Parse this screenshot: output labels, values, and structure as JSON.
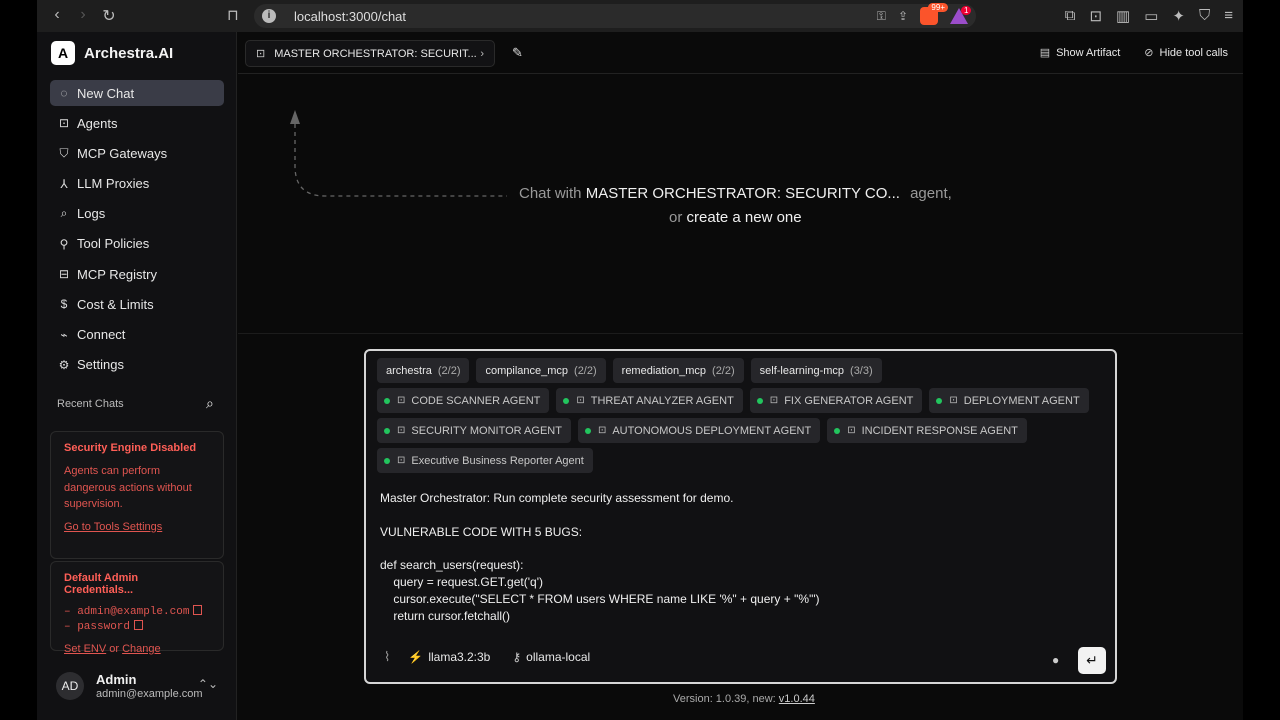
{
  "browser": {
    "url": "localhost:3000/chat",
    "badge_brave": "99+",
    "badge_alert": "1"
  },
  "app": {
    "name": "Archestra.AI",
    "logo_letter": "A"
  },
  "sidebar": {
    "items": [
      {
        "label": "New Chat",
        "icon": "chat-bubble-icon"
      },
      {
        "label": "Agents",
        "icon": "bot-icon"
      },
      {
        "label": "MCP Gateways",
        "icon": "shield-icon"
      },
      {
        "label": "LLM Proxies",
        "icon": "network-icon"
      },
      {
        "label": "Logs",
        "icon": "search-logs-icon"
      },
      {
        "label": "Tool Policies",
        "icon": "wrench-icon"
      },
      {
        "label": "MCP Registry",
        "icon": "router-icon"
      },
      {
        "label": "Cost & Limits",
        "icon": "dollar-icon"
      },
      {
        "label": "Connect",
        "icon": "plug-icon"
      },
      {
        "label": "Settings",
        "icon": "gear-icon"
      }
    ],
    "recent_label": "Recent Chats",
    "security_card": {
      "title": "Security Engine Disabled",
      "desc": "Agents can perform dangerous actions without supervision.",
      "link": "Go to Tools Settings"
    },
    "creds_card": {
      "title": "Default Admin Credentials...",
      "email": "admin@example.com",
      "password": "password",
      "set_env": "Set ENV",
      "or": "or",
      "change": "Change"
    },
    "user": {
      "initials": "AD",
      "name": "Admin",
      "email": "admin@example.com"
    }
  },
  "topbar": {
    "agent_crumb": "MASTER ORCHESTRATOR: SECURIT...",
    "show_artifact": "Show Artifact",
    "hide_tool_calls": "Hide tool calls"
  },
  "empty_state": {
    "prefix": "Chat with",
    "agent": "MASTER ORCHESTRATOR: SECURITY CO...",
    "suffix": "agent,",
    "or": "or",
    "create_link": "create a new one"
  },
  "composer": {
    "servers": [
      {
        "name": "archestra",
        "count": "(2/2)"
      },
      {
        "name": "compilance_mcp",
        "count": "(2/2)"
      },
      {
        "name": "remediation_mcp",
        "count": "(2/2)"
      },
      {
        "name": "self-learning-mcp",
        "count": "(3/3)"
      }
    ],
    "agents_row1": [
      "CODE SCANNER AGENT",
      "THREAT ANALYZER AGENT",
      "FIX GENERATOR AGENT",
      "DEPLOYMENT AGENT"
    ],
    "agents_row2": [
      "SECURITY MONITOR AGENT",
      "AUTONOMOUS DEPLOYMENT AGENT",
      "INCIDENT RESPONSE AGENT"
    ],
    "agents_row3": [
      "Executive Business Reporter Agent"
    ],
    "status_color": "#22c55e",
    "message": "Master Orchestrator: Run complete security assessment for demo.\n\nVULNERABLE CODE WITH 5 BUGS:\n\ndef search_users(request):\n    query = request.GET.get('q')\n    cursor.execute(\"SELECT * FROM users WHERE name LIKE '%\" + query + \"%'\")\n    return cursor.fetchall()",
    "model": "llama3.2:3b",
    "provider": "ollama-local"
  },
  "footer": {
    "version": "Version: 1.0.39, new:",
    "new_version": "v1.0.44"
  }
}
